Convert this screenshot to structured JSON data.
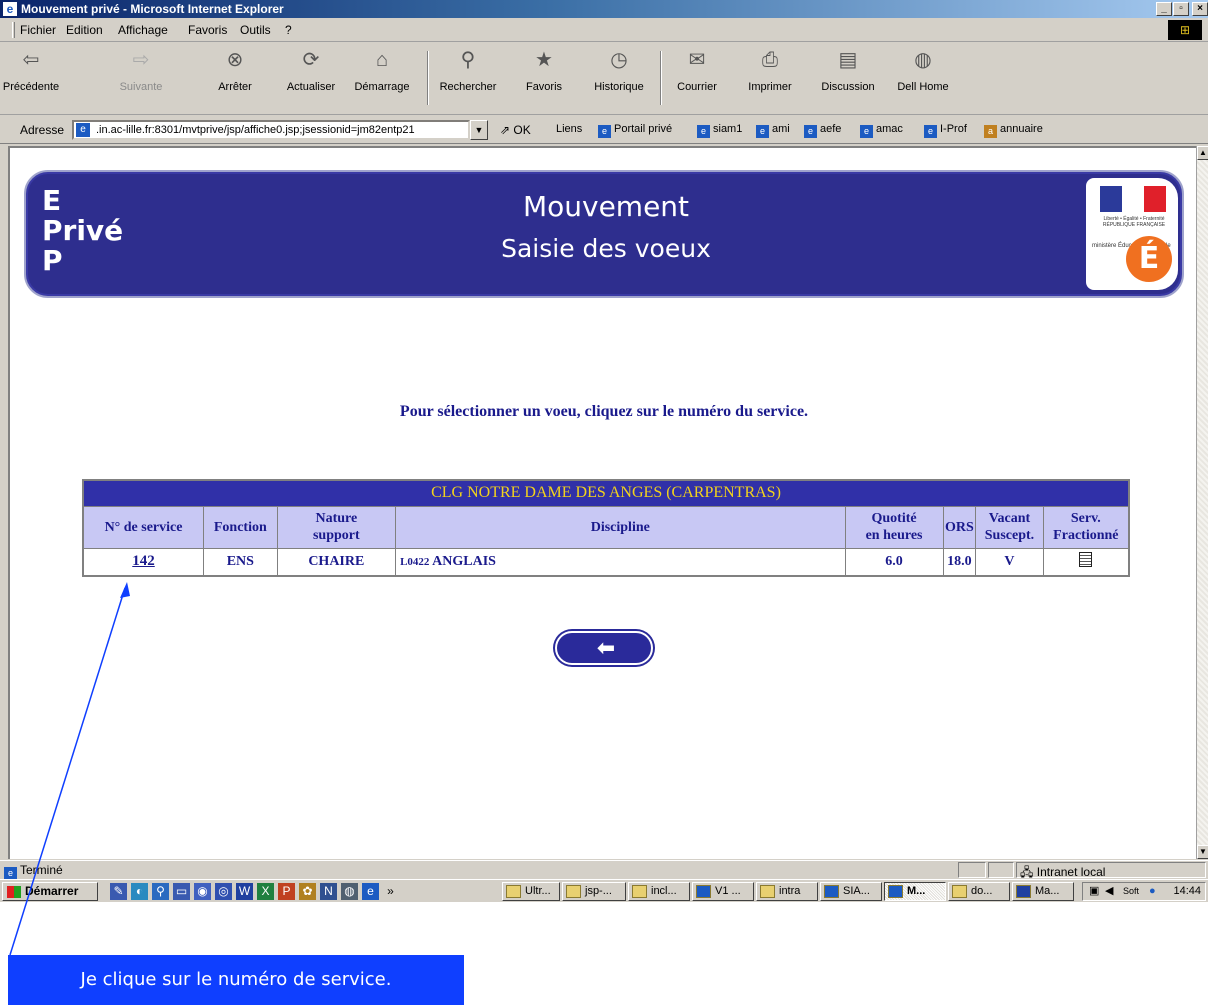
{
  "window": {
    "title": "Mouvement privé - Microsoft Internet Explorer"
  },
  "menu": [
    "Fichier",
    "Edition",
    "Affichage",
    "Favoris",
    "Outils",
    "?"
  ],
  "toolbar": {
    "buttons": [
      {
        "label": "Précédente",
        "icon": "back-arrow-icon"
      },
      {
        "label": "Suivante",
        "icon": "forward-arrow-icon",
        "disabled": true
      },
      {
        "label": "Arrêter",
        "icon": "stop-icon"
      },
      {
        "label": "Actualiser",
        "icon": "refresh-icon"
      },
      {
        "label": "Démarrage",
        "icon": "home-icon"
      },
      {
        "label": "Rechercher",
        "icon": "search-icon"
      },
      {
        "label": "Favoris",
        "icon": "favorites-icon"
      },
      {
        "label": "Historique",
        "icon": "history-icon"
      },
      {
        "label": "Courrier",
        "icon": "mail-icon"
      },
      {
        "label": "Imprimer",
        "icon": "print-icon"
      },
      {
        "label": "Discussion",
        "icon": "discussion-icon"
      },
      {
        "label": "Dell Home",
        "icon": "dell-icon"
      }
    ]
  },
  "address": {
    "label": "Adresse",
    "url": ".in.ac-lille.fr:8301/mvtprive/jsp/affiche0.jsp;jsessionid=jm82entp21",
    "go": "OK",
    "links_label": "Liens",
    "links": [
      "Portail privé",
      "siam1",
      "ami",
      "aefe",
      "amac",
      "I-Prof",
      "annuaire"
    ]
  },
  "banner": {
    "logo_lines": [
      "E",
      "Privé",
      "P"
    ],
    "title": "Mouvement",
    "subtitle": "Saisie des voeux",
    "rf_motto": "Liberté • Égalité • Fraternité RÉPUBLIQUE FRANÇAISE",
    "ministry_text": "ministère Éducation nationale",
    "ministry_letter": "É"
  },
  "instruction": "Pour sélectionner un voeu, cliquez sur le numéro du service.",
  "table": {
    "school": "CLG NOTRE DAME DES ANGES (CARPENTRAS)",
    "headers": {
      "service": "N° de service",
      "fonction": "Fonction",
      "nature_1": "Nature",
      "nature_2": "support",
      "discipline": "Discipline",
      "quotite_1": "Quotité",
      "quotite_2": "en heures",
      "ors": "ORS",
      "vacant_1": "Vacant",
      "vacant_2": "Suscept.",
      "serv_1": "Serv.",
      "serv_2": "Fractionné"
    },
    "row": {
      "service": "142",
      "fonction": "ENS",
      "nature": "CHAIRE",
      "discipline_code": "L0422",
      "discipline_label": "ANGLAIS",
      "quotite": "6.0",
      "ors": "18.0",
      "vacant": "V",
      "fractionne_icon": "document-icon"
    }
  },
  "statusbar": {
    "text": "Terminé",
    "zone": "Intranet local"
  },
  "taskbar": {
    "start": "Démarrer",
    "tasks": [
      "Ultr...",
      "jsp-...",
      "incl...",
      "V1 ...",
      "intra",
      "SIA...",
      "M...",
      "do...",
      "Ma..."
    ],
    "active_task_index": 6,
    "clock": "14:44",
    "tray_label": "Soft"
  },
  "annotation": {
    "caption": "Je clique sur le numéro de service."
  },
  "colors": {
    "banner_bg": "#2e2e8e",
    "school_header_bg": "#3030a8",
    "school_header_text": "#f2d21c",
    "column_header_bg": "#c8c8f4",
    "text_navy": "#1a1a8c",
    "annotation_bg": "#0f3fff"
  }
}
